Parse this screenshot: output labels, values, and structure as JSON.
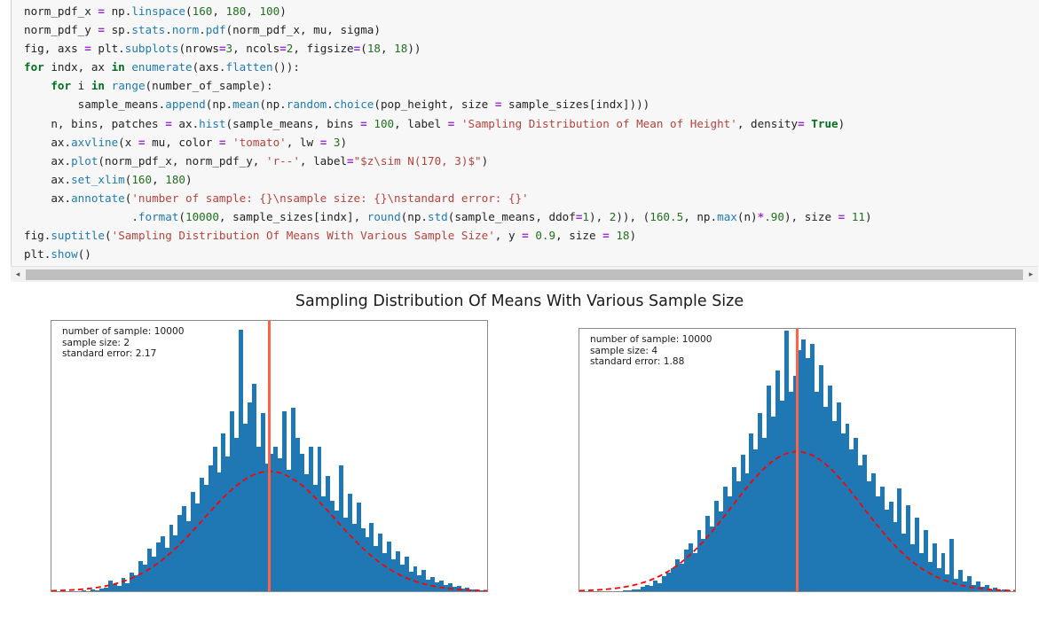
{
  "code": {
    "lines": [
      [
        {
          "t": "norm_pdf_x ",
          "c": "plain"
        },
        {
          "t": "=",
          "c": "op"
        },
        {
          "t": " np.",
          "c": "plain"
        },
        {
          "t": "linspace",
          "c": "fn"
        },
        {
          "t": "(",
          "c": "plain"
        },
        {
          "t": "160",
          "c": "num"
        },
        {
          "t": ", ",
          "c": "plain"
        },
        {
          "t": "180",
          "c": "num"
        },
        {
          "t": ", ",
          "c": "plain"
        },
        {
          "t": "100",
          "c": "num"
        },
        {
          "t": ")",
          "c": "plain"
        }
      ],
      [
        {
          "t": "norm_pdf_y ",
          "c": "plain"
        },
        {
          "t": "=",
          "c": "op"
        },
        {
          "t": " sp.",
          "c": "plain"
        },
        {
          "t": "stats",
          "c": "fn"
        },
        {
          "t": ".",
          "c": "plain"
        },
        {
          "t": "norm",
          "c": "fn"
        },
        {
          "t": ".",
          "c": "plain"
        },
        {
          "t": "pdf",
          "c": "fn"
        },
        {
          "t": "(norm_pdf_x, mu, sigma)",
          "c": "plain"
        }
      ],
      [
        {
          "t": "fig, axs ",
          "c": "plain"
        },
        {
          "t": "=",
          "c": "op"
        },
        {
          "t": " plt.",
          "c": "plain"
        },
        {
          "t": "subplots",
          "c": "fn"
        },
        {
          "t": "(nrows",
          "c": "plain"
        },
        {
          "t": "=",
          "c": "op"
        },
        {
          "t": "3",
          "c": "num"
        },
        {
          "t": ", ncols",
          "c": "plain"
        },
        {
          "t": "=",
          "c": "op"
        },
        {
          "t": "2",
          "c": "num"
        },
        {
          "t": ", figsize",
          "c": "plain"
        },
        {
          "t": "=",
          "c": "op"
        },
        {
          "t": "(",
          "c": "plain"
        },
        {
          "t": "18",
          "c": "num"
        },
        {
          "t": ", ",
          "c": "plain"
        },
        {
          "t": "18",
          "c": "num"
        },
        {
          "t": "))",
          "c": "plain"
        }
      ],
      [
        {
          "t": "for",
          "c": "kw"
        },
        {
          "t": " indx, ax ",
          "c": "plain"
        },
        {
          "t": "in",
          "c": "kw"
        },
        {
          "t": " ",
          "c": "plain"
        },
        {
          "t": "enumerate",
          "c": "fn"
        },
        {
          "t": "(axs.",
          "c": "plain"
        },
        {
          "t": "flatten",
          "c": "fn"
        },
        {
          "t": "()):",
          "c": "plain"
        }
      ],
      [
        {
          "t": "    ",
          "c": "plain"
        },
        {
          "t": "for",
          "c": "kw"
        },
        {
          "t": " i ",
          "c": "plain"
        },
        {
          "t": "in",
          "c": "kw"
        },
        {
          "t": " ",
          "c": "plain"
        },
        {
          "t": "range",
          "c": "fn"
        },
        {
          "t": "(number_of_sample):",
          "c": "plain"
        }
      ],
      [
        {
          "t": "        sample_means.",
          "c": "plain"
        },
        {
          "t": "append",
          "c": "fn"
        },
        {
          "t": "(np.",
          "c": "plain"
        },
        {
          "t": "mean",
          "c": "fn"
        },
        {
          "t": "(np.",
          "c": "plain"
        },
        {
          "t": "random",
          "c": "fn"
        },
        {
          "t": ".",
          "c": "plain"
        },
        {
          "t": "choice",
          "c": "fn"
        },
        {
          "t": "(pop_height, size ",
          "c": "plain"
        },
        {
          "t": "=",
          "c": "op"
        },
        {
          "t": " sample_sizes[indx])))",
          "c": "plain"
        }
      ],
      [
        {
          "t": "    n, bins, patches ",
          "c": "plain"
        },
        {
          "t": "=",
          "c": "op"
        },
        {
          "t": " ax.",
          "c": "plain"
        },
        {
          "t": "hist",
          "c": "fn"
        },
        {
          "t": "(sample_means, bins ",
          "c": "plain"
        },
        {
          "t": "=",
          "c": "op"
        },
        {
          "t": " ",
          "c": "plain"
        },
        {
          "t": "100",
          "c": "num"
        },
        {
          "t": ", label ",
          "c": "plain"
        },
        {
          "t": "=",
          "c": "op"
        },
        {
          "t": " ",
          "c": "plain"
        },
        {
          "t": "'Sampling Distribution of Mean of Height'",
          "c": "str"
        },
        {
          "t": ", density",
          "c": "plain"
        },
        {
          "t": "=",
          "c": "op"
        },
        {
          "t": " ",
          "c": "plain"
        },
        {
          "t": "True",
          "c": "kw"
        },
        {
          "t": ")",
          "c": "plain"
        }
      ],
      [
        {
          "t": "    ax.",
          "c": "plain"
        },
        {
          "t": "axvline",
          "c": "fn"
        },
        {
          "t": "(x ",
          "c": "plain"
        },
        {
          "t": "=",
          "c": "op"
        },
        {
          "t": " mu, color ",
          "c": "plain"
        },
        {
          "t": "=",
          "c": "op"
        },
        {
          "t": " ",
          "c": "plain"
        },
        {
          "t": "'tomato'",
          "c": "str"
        },
        {
          "t": ", lw ",
          "c": "plain"
        },
        {
          "t": "=",
          "c": "op"
        },
        {
          "t": " ",
          "c": "plain"
        },
        {
          "t": "3",
          "c": "num"
        },
        {
          "t": ")",
          "c": "plain"
        }
      ],
      [
        {
          "t": "    ax.",
          "c": "plain"
        },
        {
          "t": "plot",
          "c": "fn"
        },
        {
          "t": "(norm_pdf_x, norm_pdf_y, ",
          "c": "plain"
        },
        {
          "t": "'r--'",
          "c": "str"
        },
        {
          "t": ", label",
          "c": "plain"
        },
        {
          "t": "=",
          "c": "op"
        },
        {
          "t": "\"$z\\sim N(170, 3)$\"",
          "c": "str"
        },
        {
          "t": ")",
          "c": "plain"
        }
      ],
      [
        {
          "t": "    ax.",
          "c": "plain"
        },
        {
          "t": "set_xlim",
          "c": "fn"
        },
        {
          "t": "(",
          "c": "plain"
        },
        {
          "t": "160",
          "c": "num"
        },
        {
          "t": ", ",
          "c": "plain"
        },
        {
          "t": "180",
          "c": "num"
        },
        {
          "t": ")",
          "c": "plain"
        }
      ],
      [
        {
          "t": "    ax.",
          "c": "plain"
        },
        {
          "t": "annotate",
          "c": "fn"
        },
        {
          "t": "(",
          "c": "plain"
        },
        {
          "t": "'number of sample: {}\\nsample size: {}\\nstandard error: {}'",
          "c": "str"
        }
      ],
      [
        {
          "t": "                .",
          "c": "plain"
        },
        {
          "t": "format",
          "c": "fn"
        },
        {
          "t": "(",
          "c": "plain"
        },
        {
          "t": "10000",
          "c": "num"
        },
        {
          "t": ", sample_sizes[indx], ",
          "c": "plain"
        },
        {
          "t": "round",
          "c": "fn"
        },
        {
          "t": "(np.",
          "c": "plain"
        },
        {
          "t": "std",
          "c": "fn"
        },
        {
          "t": "(sample_means, ddof",
          "c": "plain"
        },
        {
          "t": "=",
          "c": "op"
        },
        {
          "t": "1",
          "c": "num"
        },
        {
          "t": "), ",
          "c": "plain"
        },
        {
          "t": "2",
          "c": "num"
        },
        {
          "t": ")), (",
          "c": "plain"
        },
        {
          "t": "160.5",
          "c": "num"
        },
        {
          "t": ", np.",
          "c": "plain"
        },
        {
          "t": "max",
          "c": "fn"
        },
        {
          "t": "(n)",
          "c": "plain"
        },
        {
          "t": "*",
          "c": "op"
        },
        {
          "t": ".90",
          "c": "num"
        },
        {
          "t": "), size ",
          "c": "plain"
        },
        {
          "t": "=",
          "c": "op"
        },
        {
          "t": " ",
          "c": "plain"
        },
        {
          "t": "11",
          "c": "num"
        },
        {
          "t": ")",
          "c": "plain"
        }
      ],
      [
        {
          "t": "fig.",
          "c": "plain"
        },
        {
          "t": "suptitle",
          "c": "fn"
        },
        {
          "t": "(",
          "c": "plain"
        },
        {
          "t": "'Sampling Distribution Of Means With Various Sample Size'",
          "c": "str"
        },
        {
          "t": ", y ",
          "c": "plain"
        },
        {
          "t": "=",
          "c": "op"
        },
        {
          "t": " ",
          "c": "plain"
        },
        {
          "t": "0.9",
          "c": "num"
        },
        {
          "t": ", size ",
          "c": "plain"
        },
        {
          "t": "=",
          "c": "op"
        },
        {
          "t": " ",
          "c": "plain"
        },
        {
          "t": "18",
          "c": "num"
        },
        {
          "t": ")",
          "c": "plain"
        }
      ],
      [
        {
          "t": "plt.",
          "c": "plain"
        },
        {
          "t": "show",
          "c": "fn"
        },
        {
          "t": "()",
          "c": "plain"
        }
      ]
    ],
    "scrollbar": {
      "left_arrow": "◂",
      "right_arrow": "▸"
    }
  },
  "figure": {
    "title": "Sampling Distribution Of Means With Various Sample Size"
  },
  "chart_data": [
    {
      "type": "bar",
      "title": "Sampling Distribution Of Means With Various Sample Size",
      "panel": "left",
      "xlabel": "",
      "ylabel": "",
      "xlim": [
        160.0,
        180.0
      ],
      "ylim": [
        0.0,
        0.3
      ],
      "grid": false,
      "legend": "none",
      "xticks": [
        "160.0",
        "162.5",
        "165.0",
        "167.5",
        "170.0",
        "172.5",
        "175.0",
        "177.5",
        "180.0"
      ],
      "xtick_values": [
        160.0,
        162.5,
        165.0,
        167.5,
        170.0,
        172.5,
        175.0,
        177.5,
        180.0
      ],
      "yticks": [
        "0.00",
        "0.05",
        "0.10",
        "0.15",
        "0.20",
        "0.25",
        "0.30"
      ],
      "ytick_values": [
        0.0,
        0.05,
        0.1,
        0.15,
        0.2,
        0.25,
        0.3
      ],
      "annotation": "number of sample: 10000\nsample size: 2\nstandard error: 2.17",
      "annotation_lines": [
        "number of sample: 10000",
        "sample size: 2",
        "standard error: 2.17"
      ],
      "number_of_sample": 10000,
      "sample_size": 2,
      "standard_error": 2.17,
      "bar_color": "#1f77b4",
      "vline_color": "#ff6347",
      "vline_x": 170.0,
      "pdf_curve": {
        "label": "$z\\sim N(170, 3)$",
        "color": "#ff0000",
        "style": "dashed",
        "mu": 170,
        "sigma": 3,
        "peak": 0.133
      },
      "bin_count": 100,
      "bin_left_edges": [
        160.0,
        160.2,
        160.4,
        160.6,
        160.8,
        161.0,
        161.2,
        161.4,
        161.6,
        161.8,
        162.0,
        162.2,
        162.4,
        162.6,
        162.8,
        163.0,
        163.2,
        163.4,
        163.6,
        163.8,
        164.0,
        164.2,
        164.4,
        164.6,
        164.8,
        165.0,
        165.2,
        165.4,
        165.6,
        165.8,
        166.0,
        166.2,
        166.4,
        166.6,
        166.8,
        167.0,
        167.2,
        167.4,
        167.6,
        167.8,
        168.0,
        168.2,
        168.4,
        168.6,
        168.8,
        169.0,
        169.2,
        169.4,
        169.6,
        169.8,
        170.0,
        170.2,
        170.4,
        170.6,
        170.8,
        171.0,
        171.2,
        171.4,
        171.6,
        171.8,
        172.0,
        172.2,
        172.4,
        172.6,
        172.8,
        173.0,
        173.2,
        173.4,
        173.6,
        173.8,
        174.0,
        174.2,
        174.4,
        174.6,
        174.8,
        175.0,
        175.2,
        175.4,
        175.6,
        175.8,
        176.0,
        176.2,
        176.4,
        176.6,
        176.8,
        177.0,
        177.2,
        177.4,
        177.6,
        177.8,
        178.0,
        178.2,
        178.4,
        178.6,
        178.8,
        179.0,
        179.2,
        179.4,
        179.6,
        179.8
      ],
      "values": [
        0.0,
        0.0,
        0.0,
        0.0,
        0.0,
        0.0,
        0.0,
        0.001,
        0.0,
        0.002,
        0.001,
        0.003,
        0.004,
        0.012,
        0.008,
        0.006,
        0.015,
        0.009,
        0.021,
        0.018,
        0.033,
        0.03,
        0.047,
        0.038,
        0.054,
        0.061,
        0.048,
        0.074,
        0.062,
        0.085,
        0.094,
        0.078,
        0.11,
        0.097,
        0.126,
        0.118,
        0.14,
        0.16,
        0.132,
        0.175,
        0.15,
        0.2,
        0.17,
        0.29,
        0.186,
        0.21,
        0.23,
        0.16,
        0.198,
        0.142,
        0.152,
        0.16,
        0.148,
        0.2,
        0.135,
        0.204,
        0.17,
        0.152,
        0.13,
        0.16,
        0.118,
        0.16,
        0.105,
        0.128,
        0.1,
        0.09,
        0.14,
        0.082,
        0.108,
        0.075,
        0.098,
        0.07,
        0.06,
        0.076,
        0.05,
        0.064,
        0.042,
        0.055,
        0.035,
        0.044,
        0.03,
        0.038,
        0.022,
        0.028,
        0.018,
        0.024,
        0.013,
        0.016,
        0.01,
        0.012,
        0.007,
        0.009,
        0.005,
        0.006,
        0.003,
        0.004,
        0.002,
        0.002,
        0.001,
        0.001
      ]
    },
    {
      "type": "bar",
      "title": "Sampling Distribution Of Means With Various Sample Size",
      "panel": "right",
      "xlabel": "",
      "ylabel": "",
      "xlim": [
        160.0,
        180.0
      ],
      "ylim": [
        0.0,
        0.25
      ],
      "grid": false,
      "legend": "none",
      "xticks": [
        "160.0",
        "162.5",
        "165.0",
        "167.5",
        "170.0",
        "172.5",
        "175.0",
        "177.5",
        "180.0"
      ],
      "xtick_values": [
        160.0,
        162.5,
        165.0,
        167.5,
        170.0,
        172.5,
        175.0,
        177.5,
        180.0
      ],
      "yticks": [
        "0.00",
        "0.05",
        "0.10",
        "0.15",
        "0.20",
        "0.25"
      ],
      "ytick_values": [
        0.0,
        0.05,
        0.1,
        0.15,
        0.2,
        0.25
      ],
      "annotation": "number of sample: 10000\nsample size: 4\nstandard error: 1.88",
      "annotation_lines": [
        "number of sample: 10000",
        "sample size: 4",
        "standard error: 1.88"
      ],
      "number_of_sample": 10000,
      "sample_size": 4,
      "standard_error": 1.88,
      "bar_color": "#1f77b4",
      "vline_color": "#ff6347",
      "vline_x": 170.0,
      "pdf_curve": {
        "label": "$z\\sim N(170, 3)$",
        "color": "#ff0000",
        "style": "dashed",
        "mu": 170,
        "sigma": 3,
        "peak": 0.133
      },
      "bin_count": 100,
      "bin_left_edges": [
        160.0,
        160.2,
        160.4,
        160.6,
        160.8,
        161.0,
        161.2,
        161.4,
        161.6,
        161.8,
        162.0,
        162.2,
        162.4,
        162.6,
        162.8,
        163.0,
        163.2,
        163.4,
        163.6,
        163.8,
        164.0,
        164.2,
        164.4,
        164.6,
        164.8,
        165.0,
        165.2,
        165.4,
        165.6,
        165.8,
        166.0,
        166.2,
        166.4,
        166.6,
        166.8,
        167.0,
        167.2,
        167.4,
        167.6,
        167.8,
        168.0,
        168.2,
        168.4,
        168.6,
        168.8,
        169.0,
        169.2,
        169.4,
        169.6,
        169.8,
        170.0,
        170.2,
        170.4,
        170.6,
        170.8,
        171.0,
        171.2,
        171.4,
        171.6,
        171.8,
        172.0,
        172.2,
        172.4,
        172.6,
        172.8,
        173.0,
        173.2,
        173.4,
        173.6,
        173.8,
        174.0,
        174.2,
        174.4,
        174.6,
        174.8,
        175.0,
        175.2,
        175.4,
        175.6,
        175.8,
        176.0,
        176.2,
        176.4,
        176.6,
        176.8,
        177.0,
        177.2,
        177.4,
        177.6,
        177.8,
        178.0,
        178.2,
        178.4,
        178.6,
        178.8,
        179.0,
        179.2,
        179.4,
        179.6,
        179.8
      ],
      "values": [
        0.0,
        0.0,
        0.0,
        0.0,
        0.0,
        0.0,
        0.0,
        0.0,
        0.0,
        0.0,
        0.001,
        0.001,
        0.002,
        0.002,
        0.004,
        0.006,
        0.005,
        0.01,
        0.008,
        0.014,
        0.018,
        0.022,
        0.03,
        0.026,
        0.04,
        0.046,
        0.036,
        0.058,
        0.05,
        0.072,
        0.062,
        0.086,
        0.076,
        0.1,
        0.09,
        0.118,
        0.105,
        0.13,
        0.112,
        0.15,
        0.135,
        0.17,
        0.146,
        0.196,
        0.166,
        0.21,
        0.182,
        0.248,
        0.19,
        0.205,
        0.23,
        0.24,
        0.222,
        0.236,
        0.19,
        0.215,
        0.176,
        0.196,
        0.162,
        0.18,
        0.15,
        0.16,
        0.135,
        0.146,
        0.12,
        0.13,
        0.105,
        0.112,
        0.09,
        0.1,
        0.078,
        0.085,
        0.066,
        0.098,
        0.055,
        0.082,
        0.045,
        0.07,
        0.036,
        0.058,
        0.028,
        0.046,
        0.022,
        0.036,
        0.016,
        0.05,
        0.012,
        0.02,
        0.009,
        0.014,
        0.006,
        0.009,
        0.004,
        0.006,
        0.002,
        0.003,
        0.001,
        0.002,
        0.001,
        0.0
      ]
    }
  ]
}
